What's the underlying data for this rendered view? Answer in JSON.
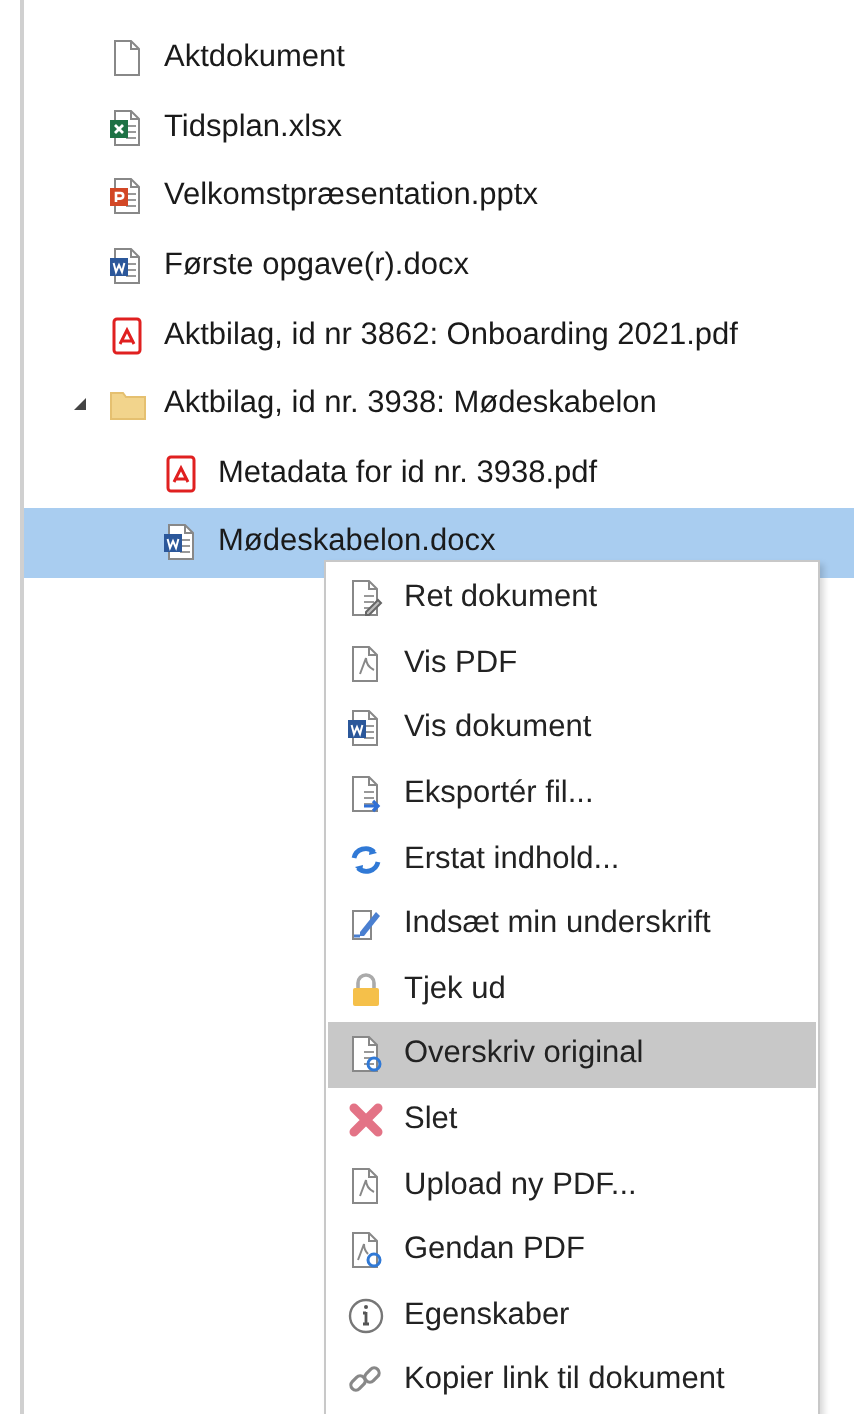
{
  "tree": [
    {
      "label": "Aktdokument",
      "kind": "blank",
      "selected": false
    },
    {
      "label": "Tidsplan.xlsx",
      "kind": "excel",
      "selected": false
    },
    {
      "label": "Velkomstpræsentation.pptx",
      "kind": "powerpoint",
      "selected": false
    },
    {
      "label": "Første opgave(r).docx",
      "kind": "word",
      "selected": false
    },
    {
      "label": "Aktbilag, id nr 3862: Onboarding 2021.pdf",
      "kind": "pdf",
      "selected": false
    },
    {
      "label": "Aktbilag, id nr. 3938: Mødeskabelon",
      "kind": "folder",
      "selected": false,
      "expanded": true,
      "children": [
        {
          "label": "Metadata for id nr. 3938.pdf",
          "kind": "pdf",
          "selected": false
        },
        {
          "label": "Mødeskabelon.docx",
          "kind": "word",
          "selected": true
        }
      ]
    }
  ],
  "context_menu": [
    {
      "label": "Ret dokument",
      "kind": "edit",
      "selected": false
    },
    {
      "label": "Vis PDF",
      "kind": "pdfoutline",
      "selected": false
    },
    {
      "label": "Vis dokument",
      "kind": "word",
      "selected": false
    },
    {
      "label": "Eksportér fil...",
      "kind": "export",
      "selected": false
    },
    {
      "label": "Erstat indhold...",
      "kind": "refresh",
      "selected": false
    },
    {
      "label": "Indsæt min underskrift",
      "kind": "sign",
      "selected": false
    },
    {
      "label": "Tjek ud",
      "kind": "lock",
      "selected": false
    },
    {
      "label": "Overskriv original",
      "kind": "overwrite",
      "selected": true
    },
    {
      "label": "Slet",
      "kind": "delete",
      "selected": false
    },
    {
      "label": "Upload ny PDF...",
      "kind": "pdfoutline",
      "selected": false
    },
    {
      "label": "Gendan PDF",
      "kind": "pdfrefresh",
      "selected": false
    },
    {
      "label": "Egenskaber",
      "kind": "info",
      "selected": false
    },
    {
      "label": "Kopier link til dokument",
      "kind": "link",
      "selected": false
    }
  ]
}
